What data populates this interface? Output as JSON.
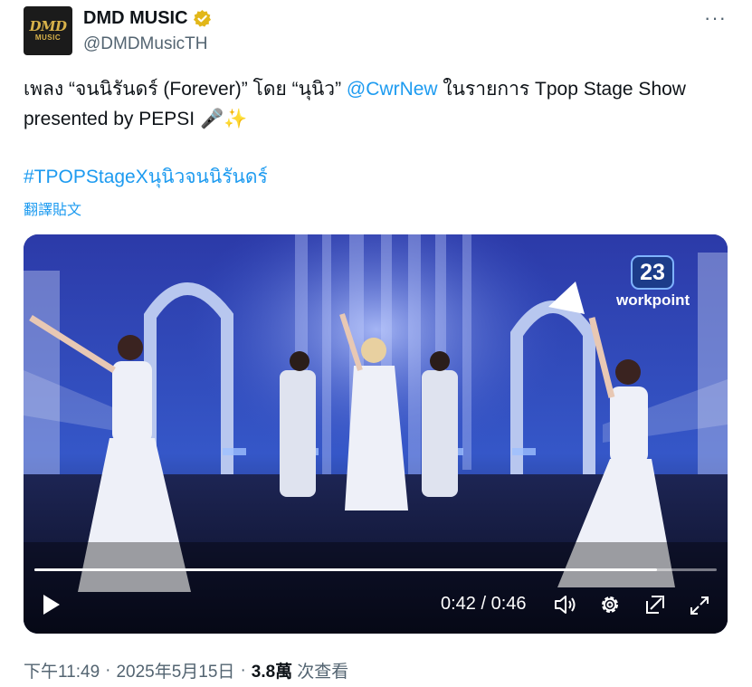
{
  "author": {
    "logo_top": "DMD",
    "logo_bottom": "MUSIC",
    "display_name": "DMD MUSIC",
    "handle": "@DMDMusicTH",
    "verified": true,
    "verified_color": "#e2b719"
  },
  "more_label": "···",
  "tweet": {
    "text_part1": "เพลง “จนนิรันดร์ (Forever)” โดย “นุนิว” ",
    "mention": "@CwrNew",
    "text_part2": " ในรายการ Tpop Stage Show presented by PEPSI 🎤✨",
    "hashtag": "#TPOPStageXนุนิวจนนิรันดร์",
    "translate_label": "翻譯貼文"
  },
  "video": {
    "channel_number": "23",
    "channel_name": "workpoint",
    "current_time": "0:42",
    "separator": " / ",
    "duration": "0:46",
    "progress_fraction": 0.913,
    "icons": [
      "play-icon",
      "volume-icon",
      "settings-icon",
      "pop-out-icon",
      "fullscreen-icon"
    ]
  },
  "meta": {
    "time": "下午11:49",
    "dot1": "·",
    "date": "2025年5月15日",
    "dot2": "·",
    "views": "3.8萬",
    "views_label": "次查看"
  },
  "colors": {
    "link": "#1d9bf0",
    "secondary_text": "#536471",
    "primary_text": "#0f1419"
  }
}
